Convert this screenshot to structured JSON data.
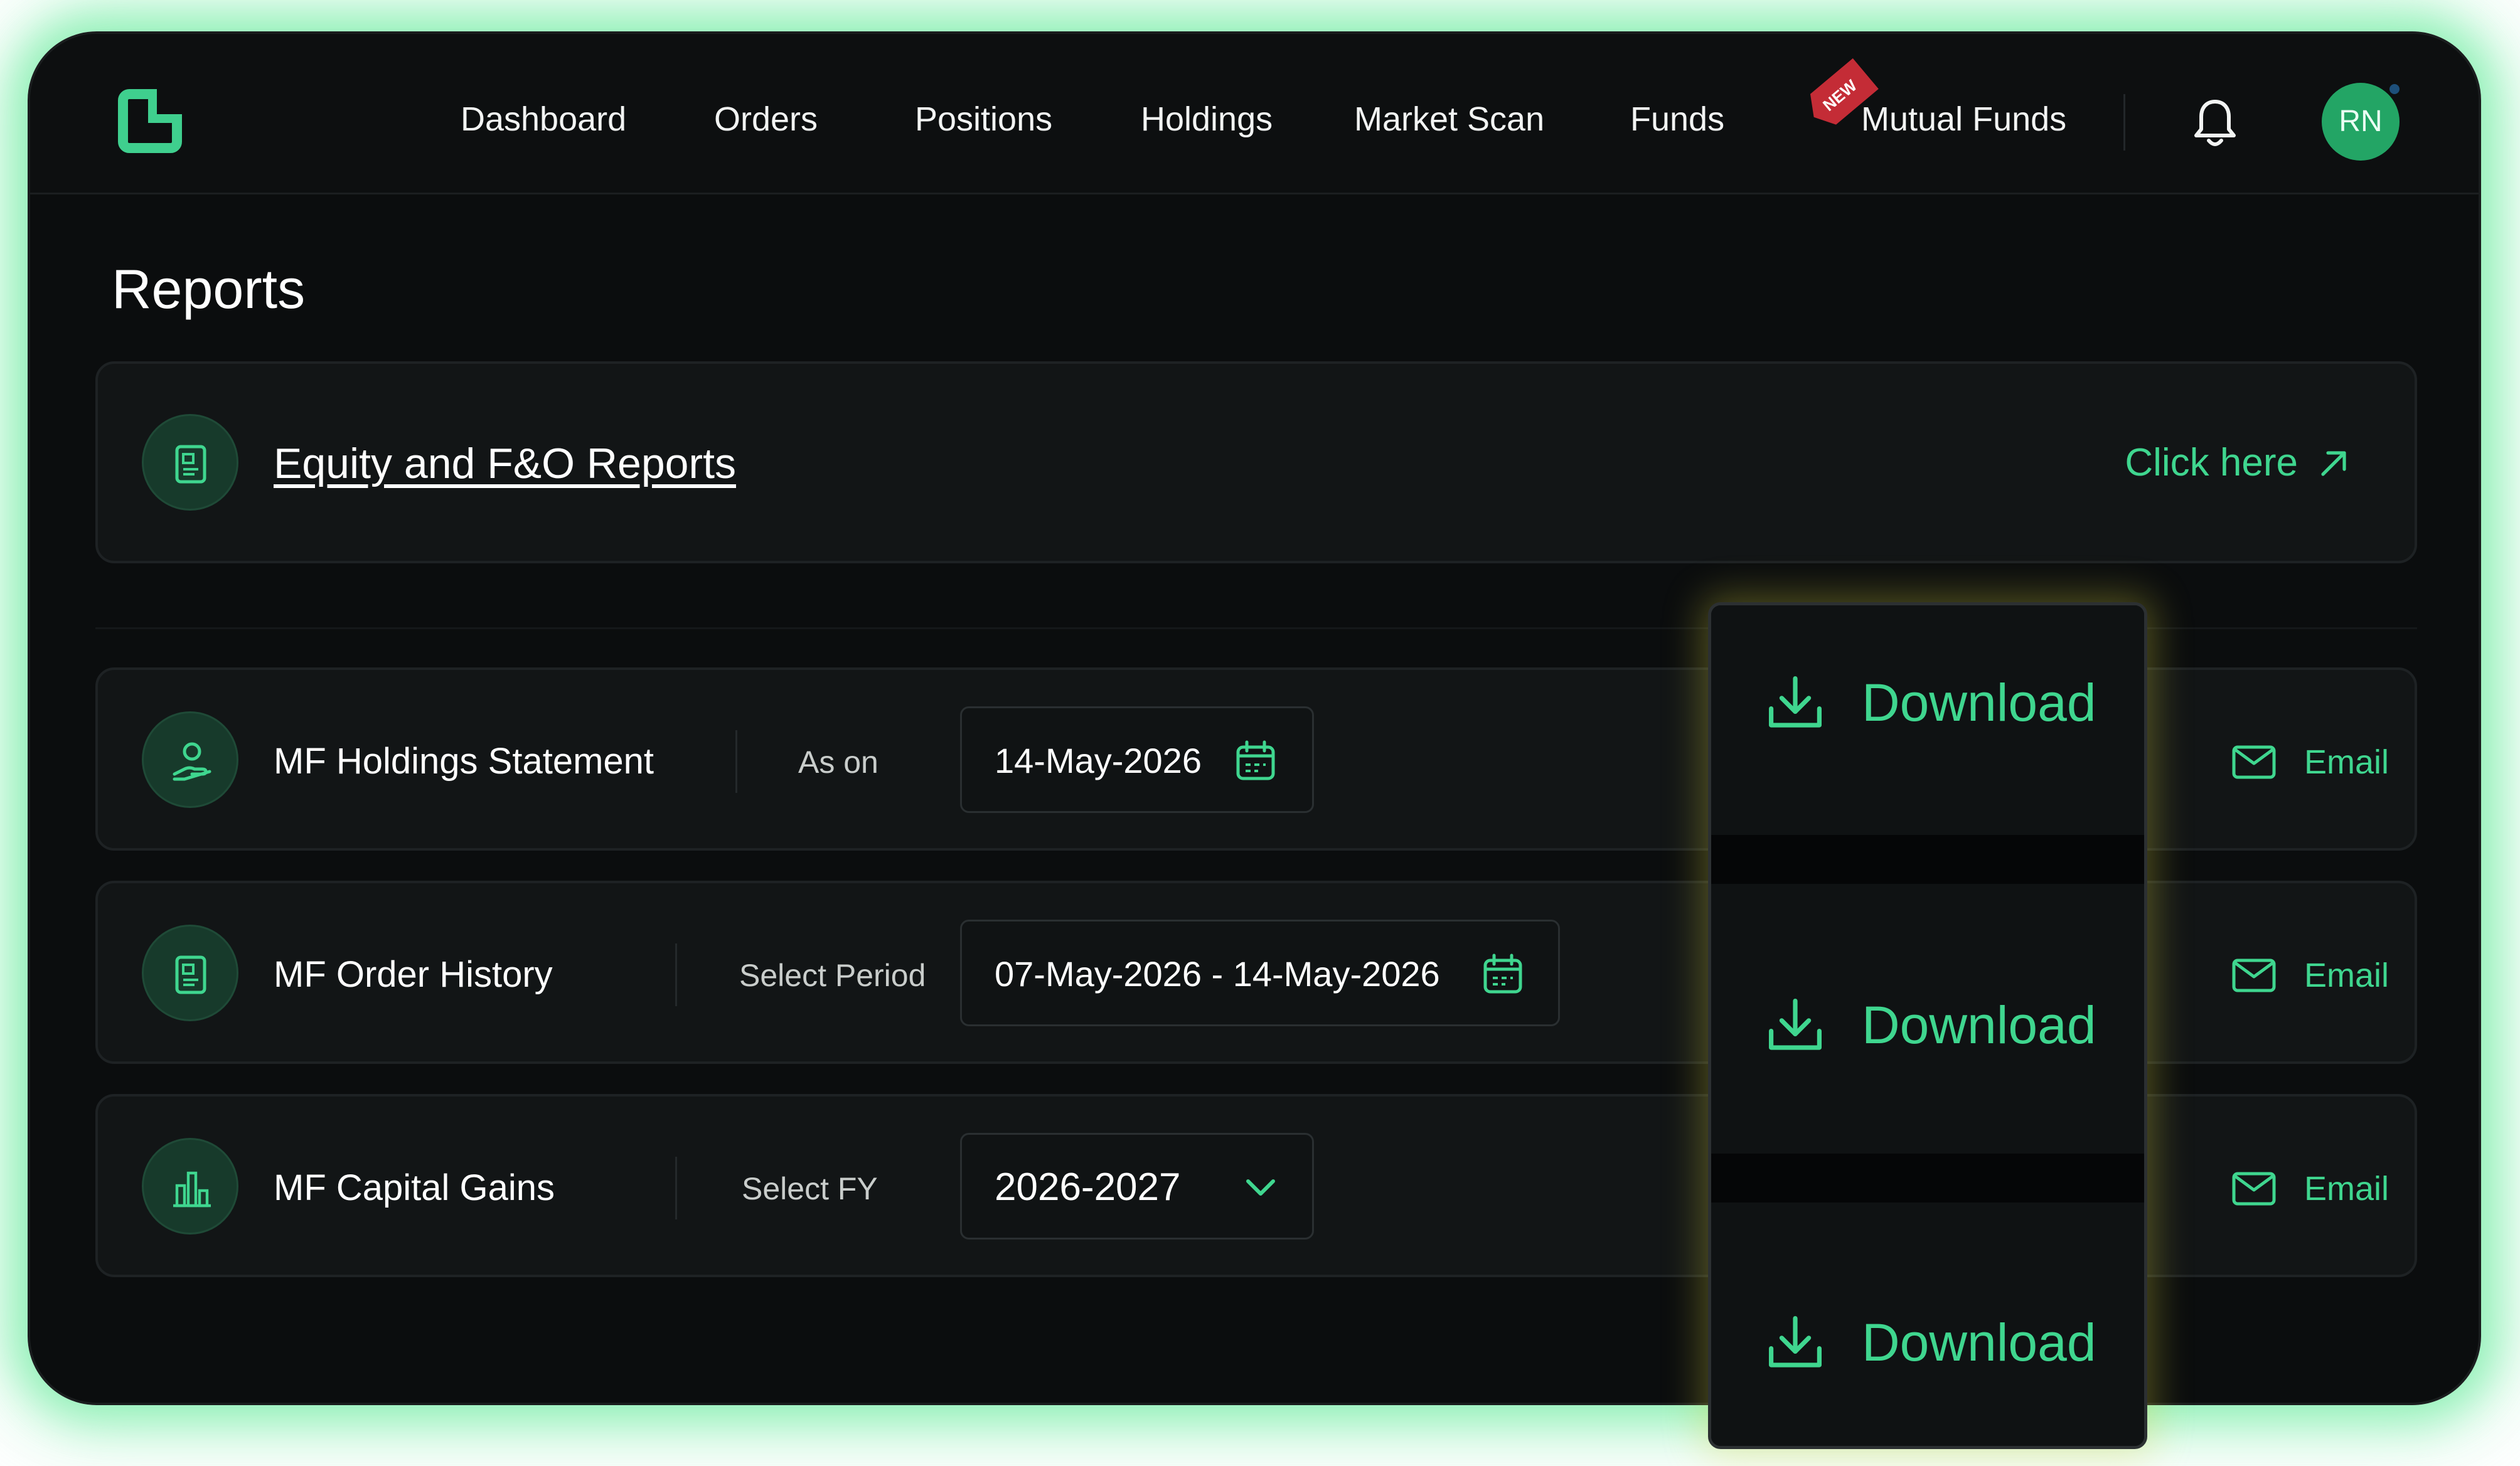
{
  "nav": {
    "items": [
      "Dashboard",
      "Orders",
      "Positions",
      "Holdings",
      "Market Scan",
      "Funds",
      "Mutual Funds"
    ],
    "new_badge": "NEW",
    "avatar_initials": "RN"
  },
  "page": {
    "title": "Reports"
  },
  "equity_card": {
    "title": "Equity and F&O Reports",
    "action": "Click here"
  },
  "reports": [
    {
      "title": "MF Holdings Statement",
      "label": "As on",
      "value": "14-May-2026",
      "control": "date",
      "email": "Email"
    },
    {
      "title": "MF Order History",
      "label": "Select Period",
      "value": "07-May-2026 - 14-May-2026",
      "control": "date-range",
      "email": "Email"
    },
    {
      "title": "MF Capital Gains",
      "label": "Select FY",
      "value": "2026-2027",
      "control": "dropdown",
      "email": "Email"
    }
  ],
  "download": {
    "label": "Download"
  },
  "colors": {
    "accent": "#3fd68f",
    "background": "#0b0d0e",
    "glow": "#4fe88a",
    "badge": "#c42c36"
  }
}
